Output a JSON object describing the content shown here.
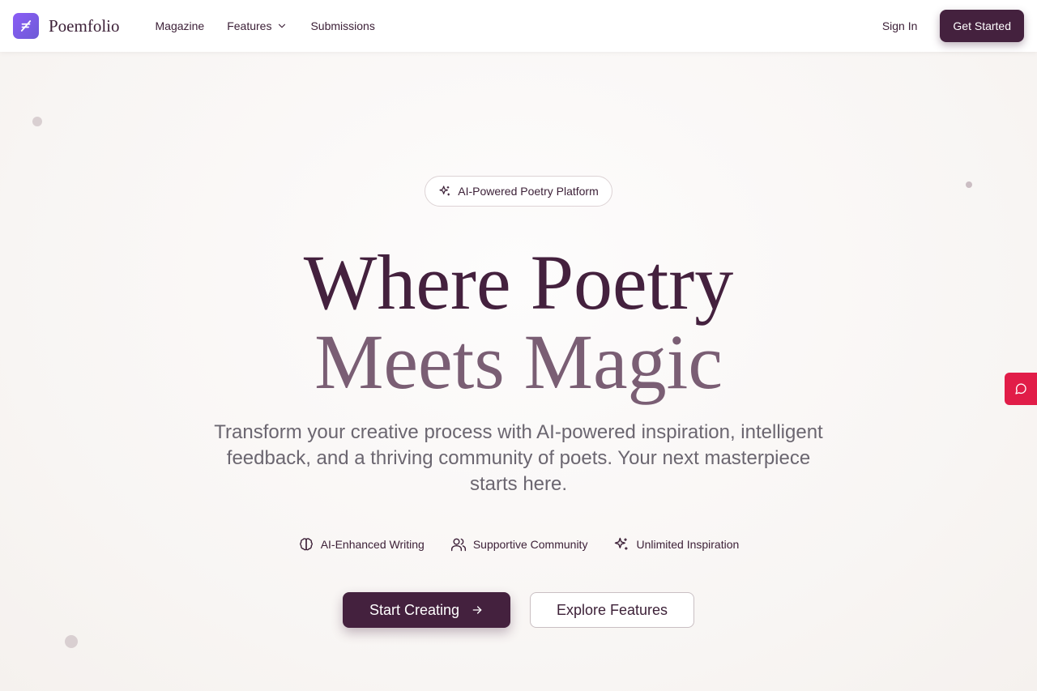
{
  "brand": {
    "name": "Poemfolio",
    "accent": "#44213e",
    "logo_color": "#7c5cf0"
  },
  "nav": {
    "links": [
      {
        "label": "Magazine"
      },
      {
        "label": "Features",
        "has_dropdown": true
      },
      {
        "label": "Submissions"
      }
    ],
    "sign_in": "Sign In",
    "get_started": "Get Started"
  },
  "hero": {
    "badge": "AI-Powered Poetry Platform",
    "headline_line1": "Where Poetry",
    "headline_line2": "Meets Magic",
    "subtitle": "Transform your creative process with AI-powered inspiration, intelligent feedback, and a thriving community of poets. Your next masterpiece starts here.",
    "features": [
      {
        "label": "AI-Enhanced Writing",
        "icon": "brain-icon"
      },
      {
        "label": "Supportive Community",
        "icon": "users-icon"
      },
      {
        "label": "Unlimited Inspiration",
        "icon": "sparkles-icon"
      }
    ],
    "primary_cta": "Start Creating",
    "secondary_cta": "Explore Features"
  },
  "feedback_tab": {
    "icon": "chat-bubble-icon",
    "color": "#e11d48"
  }
}
